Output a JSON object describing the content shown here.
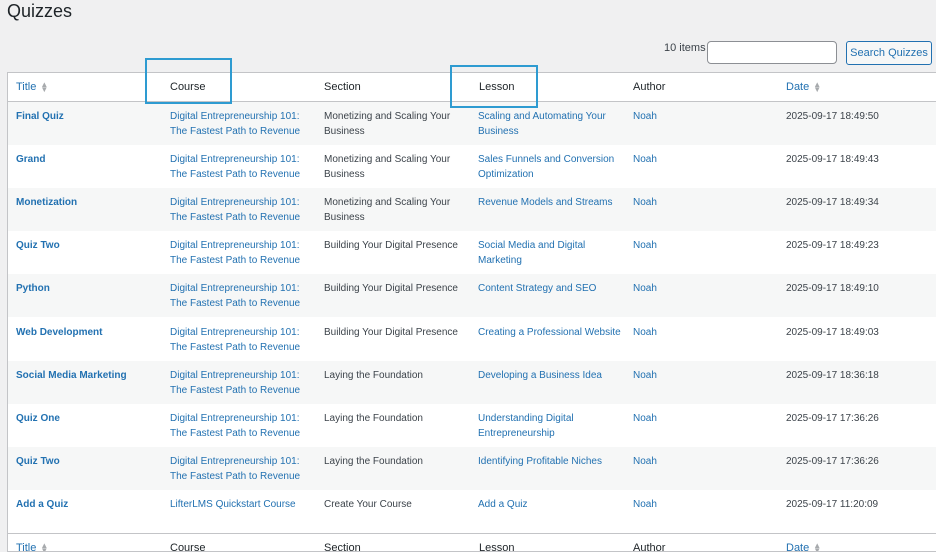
{
  "page": {
    "title": "Quizzes"
  },
  "toolbar": {
    "items_count": "10 items",
    "search_placeholder": "",
    "search_button": "Search Quizzes"
  },
  "columns": {
    "title": "Title",
    "course": "Course",
    "section": "Section",
    "lesson": "Lesson",
    "author": "Author",
    "date": "Date"
  },
  "rows": [
    {
      "title": "Final Quiz",
      "course": "Digital Entrepreneurship 101: The Fastest Path to Revenue",
      "section": "Monetizing and Scaling Your Business",
      "lesson": "Scaling and Automating Your Business",
      "author": "Noah",
      "date": "2025-09-17 18:49:50"
    },
    {
      "title": "Grand",
      "course": "Digital Entrepreneurship 101: The Fastest Path to Revenue",
      "section": "Monetizing and Scaling Your Business",
      "lesson": "Sales Funnels and Conversion Optimization",
      "author": "Noah",
      "date": "2025-09-17 18:49:43"
    },
    {
      "title": "Monetization",
      "course": "Digital Entrepreneurship 101: The Fastest Path to Revenue",
      "section": "Monetizing and Scaling Your Business",
      "lesson": "Revenue Models and Streams",
      "author": "Noah",
      "date": "2025-09-17 18:49:34"
    },
    {
      "title": "Quiz Two",
      "course": "Digital Entrepreneurship 101: The Fastest Path to Revenue",
      "section": "Building Your Digital Presence",
      "lesson": "Social Media and Digital Marketing",
      "author": "Noah",
      "date": "2025-09-17 18:49:23"
    },
    {
      "title": "Python",
      "course": "Digital Entrepreneurship 101: The Fastest Path to Revenue",
      "section": "Building Your Digital Presence",
      "lesson": "Content Strategy and SEO",
      "author": "Noah",
      "date": "2025-09-17 18:49:10"
    },
    {
      "title": "Web Development",
      "course": "Digital Entrepreneurship 101: The Fastest Path to Revenue",
      "section": "Building Your Digital Presence",
      "lesson": "Creating a Professional Website",
      "author": "Noah",
      "date": "2025-09-17 18:49:03"
    },
    {
      "title": "Social Media Marketing",
      "course": "Digital Entrepreneurship 101: The Fastest Path to Revenue",
      "section": "Laying the Foundation",
      "lesson": "Developing a Business Idea",
      "author": "Noah",
      "date": "2025-09-17 18:36:18"
    },
    {
      "title": "Quiz One",
      "course": "Digital Entrepreneurship 101: The Fastest Path to Revenue",
      "section": "Laying the Foundation",
      "lesson": "Understanding Digital Entrepreneurship",
      "author": "Noah",
      "date": "2025-09-17 17:36:26"
    },
    {
      "title": "Quiz Two",
      "course": "Digital Entrepreneurship 101: The Fastest Path to Revenue",
      "section": "Laying the Foundation",
      "lesson": "Identifying Profitable Niches",
      "author": "Noah",
      "date": "2025-09-17 17:36:26"
    },
    {
      "title": "Add a Quiz",
      "course": "LifterLMS Quickstart Course",
      "section": "Create Your Course",
      "lesson": "Add a Quiz",
      "author": "Noah",
      "date": "2025-09-17 11:20:09"
    }
  ],
  "colors": {
    "link": "#2271b1",
    "highlight": "#2e9bd1",
    "background": "#f0f0f1",
    "row_alt": "#f6f7f7"
  }
}
